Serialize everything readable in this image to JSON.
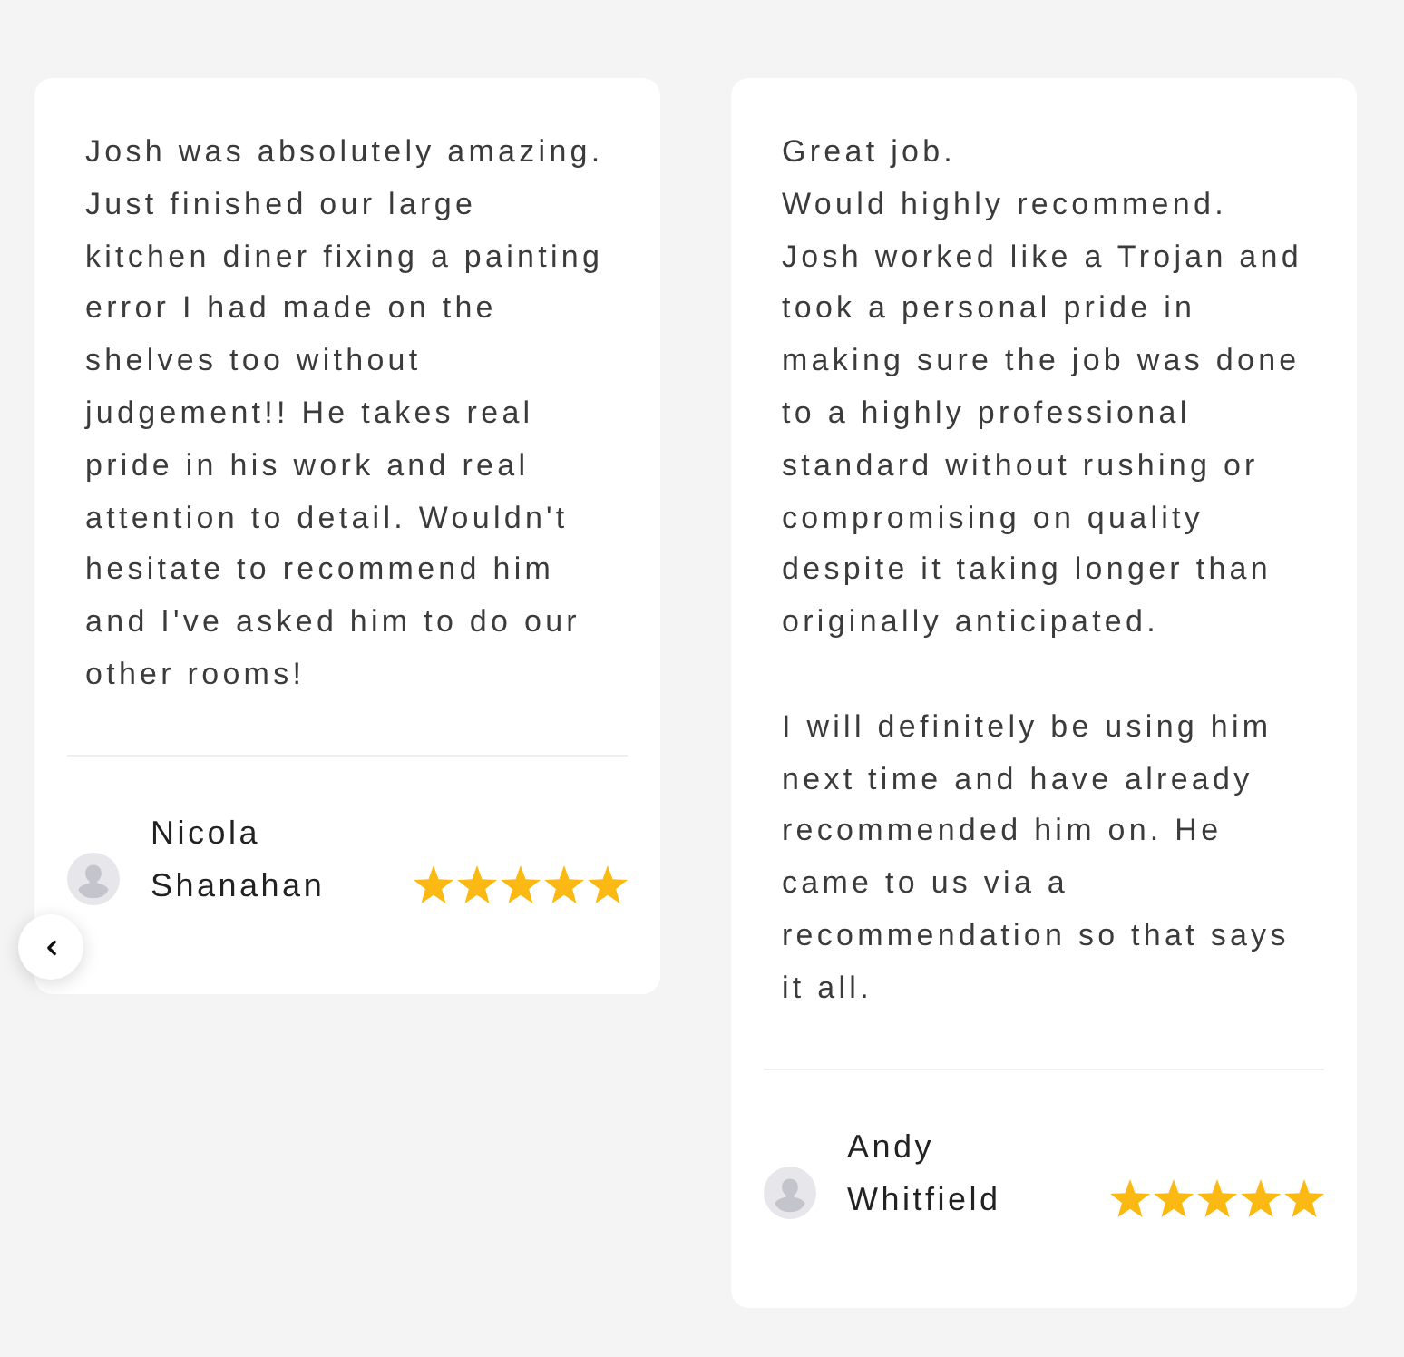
{
  "reviews": [
    {
      "text": "Josh was absolutely amazing. Just finished our large kitchen diner fixing a painting error I had made on the shelves too without judgement!! He takes real pride in his work and real attention to detail. Wouldn't hesitate to recommend him and I've asked him to do our other rooms!",
      "author": "Nicola Shanahan",
      "stars": 5
    },
    {
      "text": "Great job.\nWould highly recommend.\nJosh worked like a Trojan and took a personal pride in making sure the job was done to a highly professional standard without rushing or compromising on quality despite it taking longer than originally anticipated.\n\nI will definitely be using him next time and have already recommended him on. He came to us via a recommendation so that says it all.",
      "author": "Andy Whitfield",
      "stars": 5
    }
  ]
}
